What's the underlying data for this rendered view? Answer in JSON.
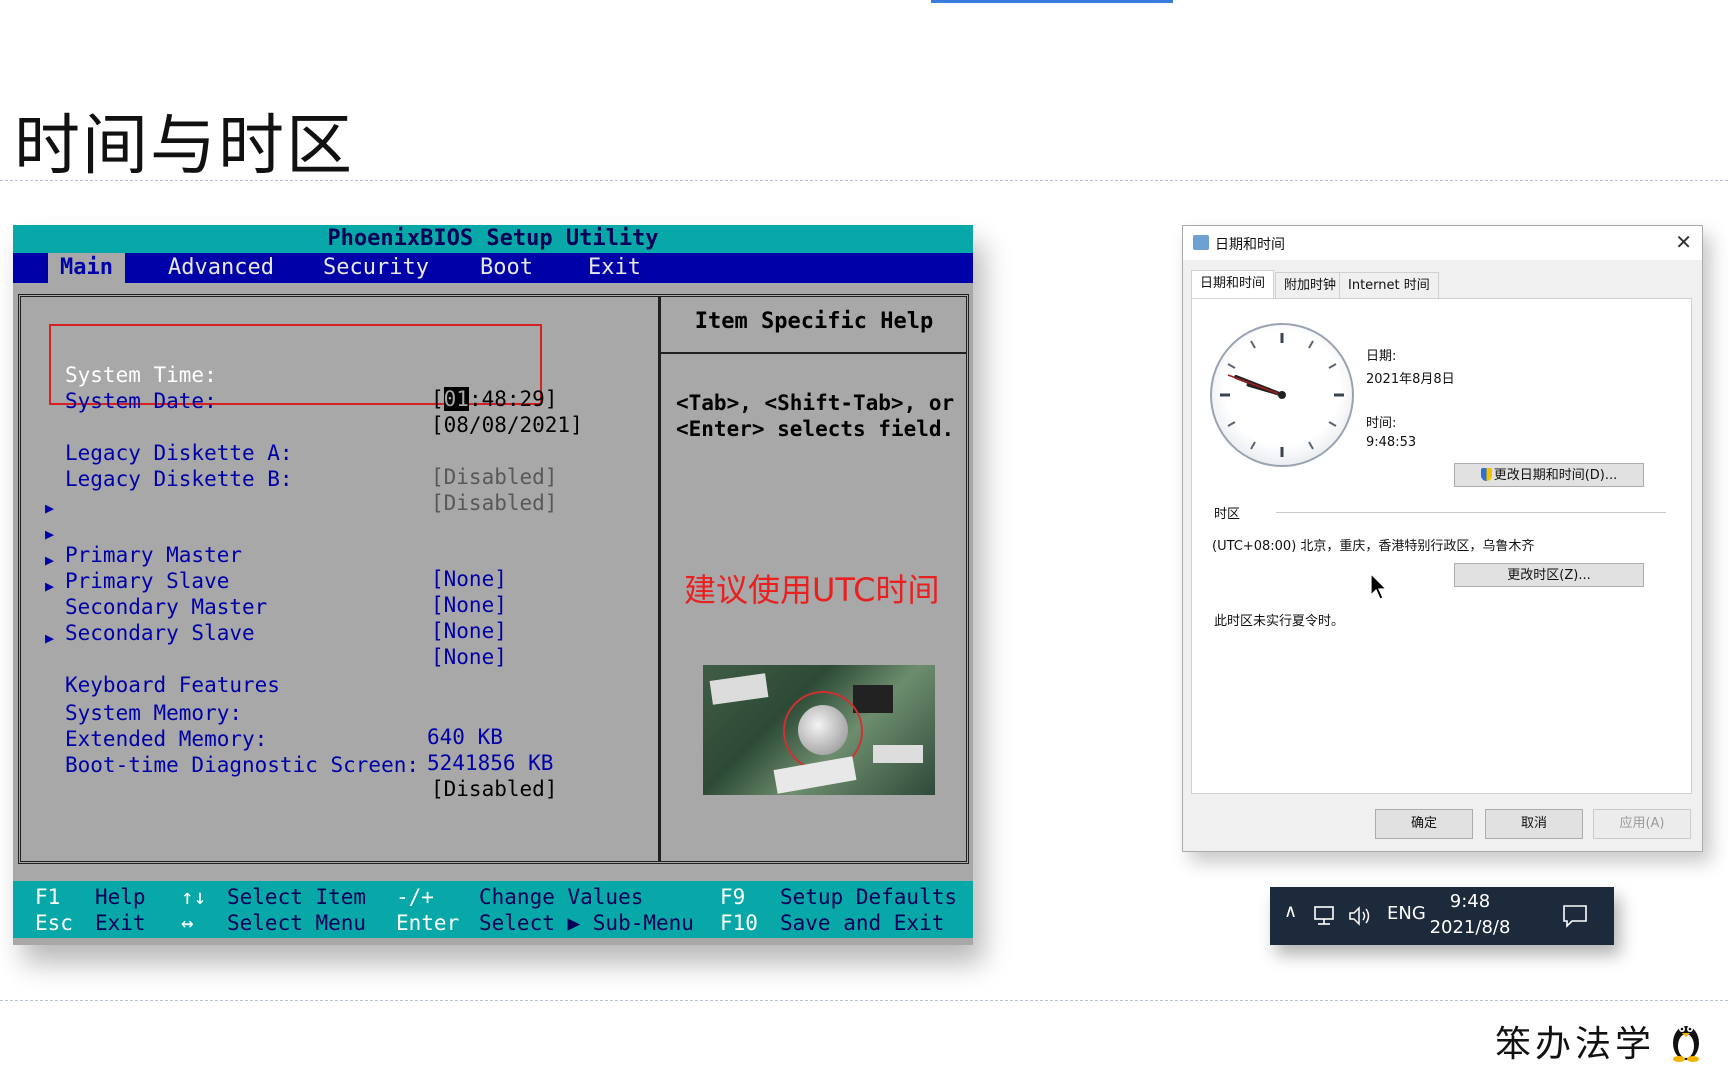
{
  "slide": {
    "title": "时间与时区",
    "watermark": "笨办法学"
  },
  "bios": {
    "title": "PhoenixBIOS Setup Utility",
    "menu": [
      "Main",
      "Advanced",
      "Security",
      "Boot",
      "Exit"
    ],
    "active_menu": "Main",
    "fields": {
      "system_time": {
        "label": "System Time:",
        "hour": "01",
        "rest": ":48:29]",
        "open_bracket": "["
      },
      "system_date": {
        "label": "System Date:",
        "value": "[08/08/2021]"
      },
      "legacy_a": {
        "label": "Legacy Diskette A:",
        "value": "[Disabled]"
      },
      "legacy_b": {
        "label": "Legacy Diskette B:",
        "value": "[Disabled]"
      },
      "primary_master": {
        "label": "Primary Master",
        "value": "[None]"
      },
      "primary_slave": {
        "label": "Primary Slave",
        "value": "[None]"
      },
      "secondary_master": {
        "label": "Secondary Master",
        "value": "[None]"
      },
      "secondary_slave": {
        "label": "Secondary Slave",
        "value": "[None]"
      },
      "keyboard_features": {
        "label": "Keyboard Features"
      },
      "system_memory": {
        "label": "System Memory:",
        "value": "640 KB"
      },
      "extended_memory": {
        "label": "Extended Memory:",
        "value": "5241856 KB"
      },
      "boot_diag": {
        "label": "Boot-time Diagnostic Screen:",
        "value": "[Disabled]"
      }
    },
    "help": {
      "title": "Item Specific Help",
      "line1": "<Tab>, <Shift-Tab>, or",
      "line2": "<Enter> selects field.",
      "note": "建议使用UTC时间"
    },
    "footer": {
      "f1_key": "F1",
      "f1_desc": "Help",
      "esc_key": "Esc",
      "esc_desc": "Exit",
      "updown_key": "↑↓",
      "updown_desc": "Select Item",
      "leftright_key": "↔",
      "leftright_desc": "Select Menu",
      "pm_key": "-/+",
      "pm_desc": "Change Values",
      "enter_key": "Enter",
      "enter_desc": "Select ▶ Sub-Menu",
      "f9_key": "F9",
      "f9_desc": "Setup Defaults",
      "f10_key": "F10",
      "f10_desc": "Save and Exit"
    }
  },
  "dialog": {
    "title": "日期和时间",
    "close": "✕",
    "tabs": [
      "日期和时间",
      "附加时钟",
      "Internet 时间"
    ],
    "date_label": "日期:",
    "date_value": "2021年8月8日",
    "time_label": "时间:",
    "time_value": "9:48:53",
    "change_datetime_button": "更改日期和时间(D)...",
    "timezone_label": "时区",
    "timezone_value": "(UTC+08:00) 北京，重庆，香港特别行政区，乌鲁木齐",
    "change_timezone_button": "更改时区(Z)...",
    "dst_note": "此时区未实行夏令时。",
    "ok_button": "确定",
    "cancel_button": "取消",
    "apply_button": "应用(A)"
  },
  "taskbar": {
    "language": "ENG",
    "time": "9:48",
    "date": "2021/8/8"
  }
}
